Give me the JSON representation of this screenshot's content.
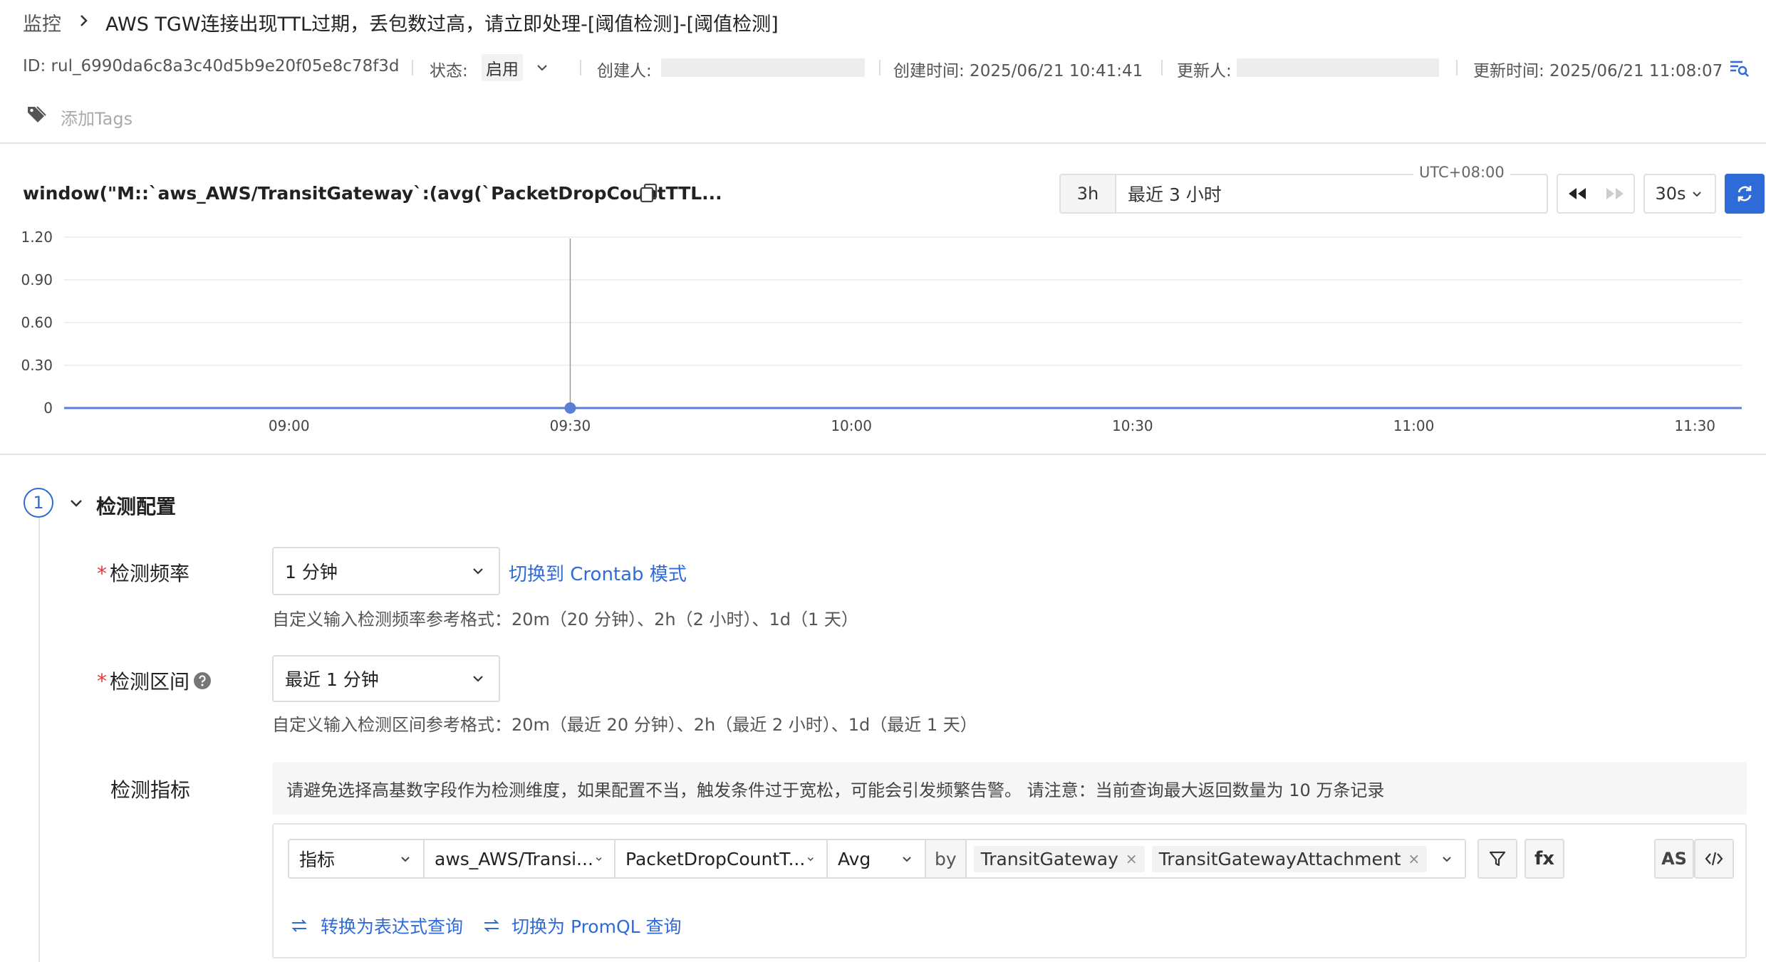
{
  "breadcrumb": {
    "parent": "监控",
    "title": "AWS TGW连接出现TTL过期，丢包数过高，请立即处理-[阈值检测]-[阈值检测]"
  },
  "meta": {
    "id": "ID: rul_6990da6c8a3c40d5b9e20f05e8c78f3d",
    "status_label": "状态:",
    "status_value": "启用",
    "creator_label": "创建人:",
    "created_time": "创建时间: 2025/06/21 10:41:41",
    "updater_label": "更新人:",
    "updated_time": "更新时间: 2025/06/21 11:08:07"
  },
  "tags": {
    "placeholder": "添加Tags"
  },
  "chart_toolbar": {
    "query_title": "window(\"M::`aws_AWS/TransitGateway`:(avg(`PacketDropCountTTL...",
    "range_short": "3h",
    "range_label": "最近 3 小时",
    "timezone": "UTC+08:00",
    "refresh_interval": "30s"
  },
  "chart_data": {
    "type": "line",
    "x": [
      "08:36",
      "09:00",
      "09:30",
      "10:00",
      "10:30",
      "11:00",
      "11:30",
      "11:35"
    ],
    "xticks": [
      "09:00",
      "09:30",
      "10:00",
      "10:30",
      "11:00",
      "11:30"
    ],
    "yticks": [
      "1.20",
      "0.90",
      "0.60",
      "0.30",
      "0"
    ],
    "ylim": [
      0,
      1.2
    ],
    "series": [
      {
        "values": [
          0,
          0,
          0,
          0,
          0,
          0,
          0,
          0
        ],
        "color": "#5b7fd6"
      }
    ],
    "marker": {
      "x": "09:30",
      "y": 0
    },
    "grid": true
  },
  "config": {
    "step_number": "1",
    "section_title": "检测配置",
    "frequency": {
      "label": "检测频率",
      "value": "1 分钟",
      "switch_link": "切换到 Crontab 模式",
      "hint": "自定义输入检测频率参考格式：20m（20 分钟）、2h（2 小时）、1d（1 天）"
    },
    "interval": {
      "label": "检测区间",
      "value": "最近 1 分钟",
      "hint": "自定义输入检测区间参考格式：20m（最近 20 分钟）、2h（最近 2 小时）、1d（最近 1 天）"
    },
    "metric": {
      "label": "检测指标",
      "notice": "请避免选择高基数字段作为检测维度，如果配置不当，触发条件过于宽松，可能会引发频繁告警。 请注意：当前查询最大返回数量为 10 万条记录",
      "type": "指标",
      "measurement": "aws_AWS/Transi...",
      "field": "PacketDropCountT...",
      "aggregation": "Avg",
      "by_label": "by",
      "group_by": [
        "TransitGateway",
        "TransitGatewayAttachment"
      ],
      "fx_label": "fx",
      "as_label": "AS",
      "convert_expression": "转换为表达式查询",
      "switch_promql": "切换为 PromQL 查询"
    }
  },
  "colors": {
    "accent": "#2f6bd8",
    "required": "#e0383e",
    "series": "#5b7fd6"
  }
}
